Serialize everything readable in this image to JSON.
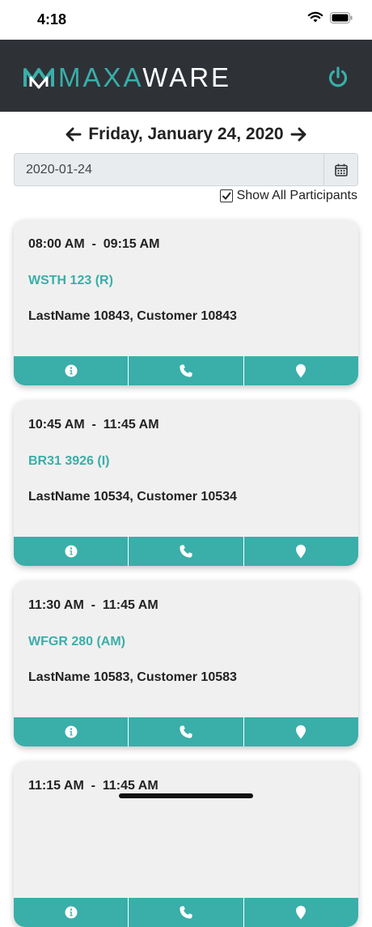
{
  "status": {
    "time": "4:18"
  },
  "header": {
    "logo_part1": "MAXA",
    "logo_part2": "WARE",
    "accent_color": "#3aaea9",
    "dark_color": "#2e3237"
  },
  "date_nav": {
    "title": "Friday, January 24, 2020",
    "prev_icon": "arrow-left-icon",
    "next_icon": "arrow-right-icon"
  },
  "date_field": {
    "value": "2020-01-24"
  },
  "show_all": {
    "label": "Show All Participants",
    "checked": true
  },
  "appointments": [
    {
      "start": "08:00 AM",
      "end": "09:15 AM",
      "code": "WSTH 123 (R)",
      "name": "LastName 10843, Customer 10843"
    },
    {
      "start": "10:45 AM",
      "end": "11:45 AM",
      "code": "BR31 3926 (I)",
      "name": "LastName 10534, Customer 10534"
    },
    {
      "start": "11:30 AM",
      "end": "11:45 AM",
      "code": "WFGR 280 (AM)",
      "name": "LastName 10583, Customer 10583"
    },
    {
      "start": "11:15 AM",
      "end": "11:45 AM",
      "code": "",
      "name": ""
    }
  ]
}
